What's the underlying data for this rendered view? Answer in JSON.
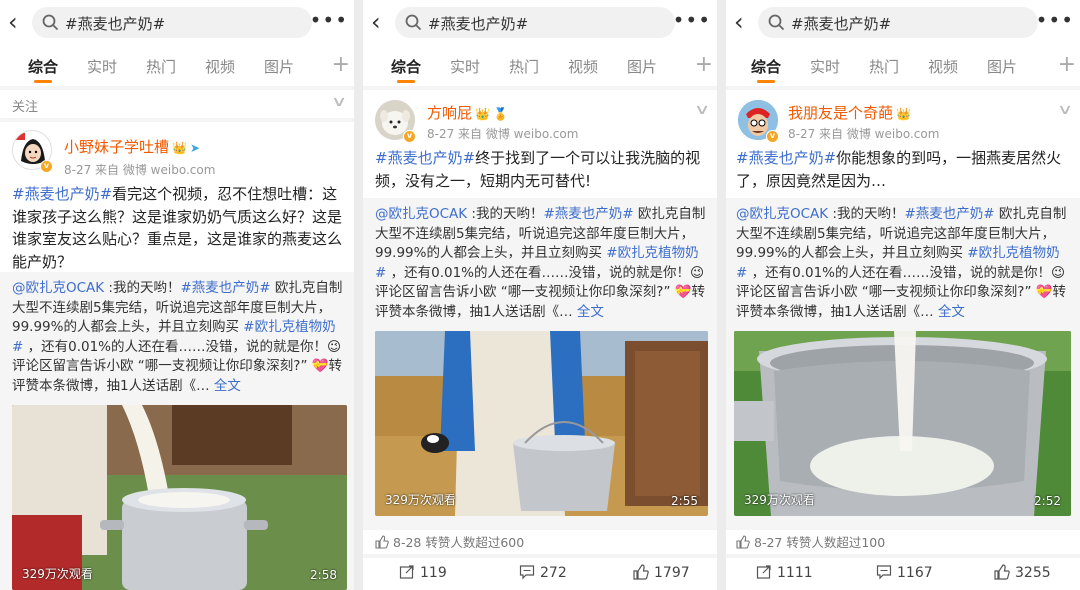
{
  "search": {
    "query": "#燕麦也产奶#"
  },
  "tabs": [
    "综合",
    "实时",
    "热门",
    "视频",
    "图片"
  ],
  "colors": {
    "accent": "#ff8200",
    "link": "#3d6dcc",
    "username": "#f15a00"
  },
  "panels": [
    {
      "section_label": "关注",
      "user": {
        "name": "小野妹子学吐槽"
      },
      "meta": "8-27  来自 微博 weibo.com",
      "text_tag": "#燕麦也产奶#",
      "text_body": "看完这个视频，忍不住想吐槽：这谁家孩子这么熊？这是谁家奶奶气质这么好？这是谁家室友这么贴心？重点是，这是谁家的燕麦这么能产奶？",
      "repost": {
        "mention": "@欧扎克OCAK",
        "p1": " :我的天哟！",
        "tag1": "#燕麦也产奶#",
        "p2": " 欧扎克自制大型不连续剧5集完结，听说追完这部年度巨制大片，99.99%的人都会上头，并且立刻购买 ",
        "tag2": "#欧扎克植物奶#",
        "p3": " ，还有0.01%的人还在看……没错，说的就是你！😉 评论区留言告诉小欧 “哪一支视频让你印象深刻?” 💝转评赞本条微博，抽1人送话剧《…",
        "full": " 全文"
      },
      "video": {
        "views": "329万次观看",
        "duration": "2:58"
      }
    },
    {
      "user": {
        "name": "方响屁"
      },
      "meta": "8-27  来自 微博  weibo.com",
      "text_tag": "#燕麦也产奶#",
      "text_body": "终于找到了一个可以让我洗脑的视频，没有之一，短期内无可替代!",
      "repost": {
        "mention": "@欧扎克OCAK",
        "p1": " :我的天哟！",
        "tag1": "#燕麦也产奶#",
        "p2": " 欧扎克自制大型不连续剧5集完结，听说追完这部年度巨制大片，99.99%的人都会上头，并且立刻购买 ",
        "tag2": "#欧扎克植物奶#",
        "p3": " ，还有0.01%的人还在看……没错，说的就是你！😉 评论区留言告诉小欧 “哪一支视频让你印象深刻?” 💝转评赞本条微博，抽1人送话剧《…",
        "full": " 全文"
      },
      "video": {
        "views": "329万次观看",
        "duration": "2:55"
      },
      "like_line": "8-28  转赞人数超过600",
      "actions": {
        "repost": "119",
        "comment": "272",
        "like": "1797"
      }
    },
    {
      "user": {
        "name": "我朋友是个奇葩"
      },
      "meta": "8-27  来自 微博  weibo.com",
      "text_tag": "#燕麦也产奶#",
      "text_body": "你能想象的到吗，一捆燕麦居然火了，原因竟然是因为…",
      "repost": {
        "mention": "@欧扎克OCAK",
        "p1": " :我的天哟！",
        "tag1": "#燕麦也产奶#",
        "p2": " 欧扎克自制大型不连续剧5集完结，听说追完这部年度巨制大片，99.99%的人都会上头，并且立刻购买 ",
        "tag2": "#欧扎克植物奶#",
        "p3": " ，还有0.01%的人还在看……没错，说的就是你！😉 评论区留言告诉小欧 “哪一支视频让你印象深刻?” 💝转评赞本条微博，抽1人送话剧《…",
        "full": " 全文"
      },
      "video": {
        "views": "329万次观看",
        "duration": "2:52"
      },
      "like_line": "8-27  转赞人数超过100",
      "actions": {
        "repost": "1111",
        "comment": "1167",
        "like": "3255"
      }
    }
  ]
}
